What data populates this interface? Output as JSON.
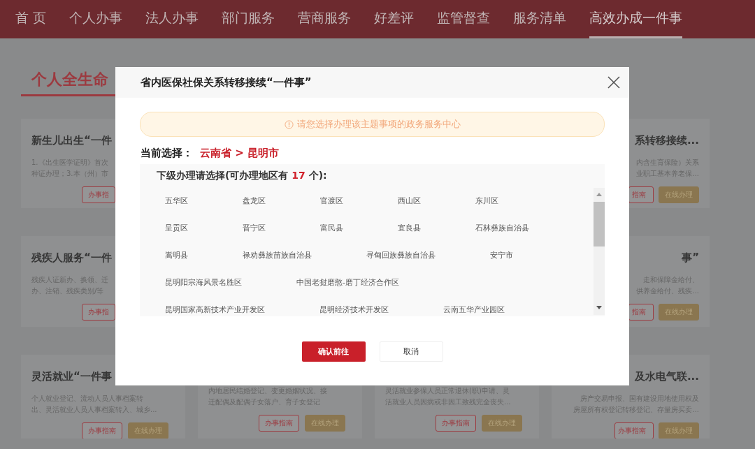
{
  "nav": [
    {
      "label": "首 页",
      "selected": false
    },
    {
      "label": "个人办事",
      "selected": false
    },
    {
      "label": "法人办事",
      "selected": false
    },
    {
      "label": "部门服务",
      "selected": false
    },
    {
      "label": "营商服务",
      "selected": false
    },
    {
      "label": "好差评",
      "selected": false
    },
    {
      "label": "监管督查",
      "selected": false
    },
    {
      "label": "服务清单",
      "selected": false
    },
    {
      "label": "高效办成一件事",
      "selected": true
    }
  ],
  "section_title": "个人全生命",
  "cards_left": [
    {
      "title": "新生儿出生“一件",
      "desc": [
        "1.《出生医学证明》首次",
        "种证办理；3.本（州）市"
      ],
      "buttons": [
        {
          "label": "办事指",
          "kind": "guide"
        }
      ]
    },
    {
      "title": "残疾人服务“一件",
      "desc": [
        "残疾人证新办、换领、迁",
        "办、注销、残疾类别/等"
      ],
      "buttons": [
        {
          "label": "办事指",
          "kind": "guide"
        }
      ]
    },
    {
      "title": "灵活就业“一件事",
      "desc": [
        "个人就业登记、流动人员人事档案转",
        "出、灵活就业人员人事档案转入、城乡..."
      ],
      "buttons": [
        {
          "label": "办事指南",
          "kind": "guide"
        },
        {
          "label": "在线办理",
          "kind": "online"
        }
      ]
    }
  ],
  "cards_bottom_middle": [
    {
      "desc": [
        "内地居民结婚登记、变更婚姻状况、接",
        "迁配偶及配偶子女落户、育子女登记"
      ],
      "buttons": [
        {
          "label": "办事指南",
          "kind": "guide"
        },
        {
          "label": "在线办理",
          "kind": "online"
        }
      ]
    },
    {
      "desc": [
        "灵活就业参保人员正常退休(职)申请、灵",
        "活就业人员因病或非因工致残完全丧失..."
      ],
      "buttons": [
        {
          "label": "办事指南",
          "kind": "guide"
        },
        {
          "label": "在线办理",
          "kind": "online"
        }
      ]
    }
  ],
  "cards_right": [
    {
      "title": "系转移接续...",
      "desc": [
        "内含生育保险）关系",
        "业职工基本养老保..."
      ],
      "buttons": [
        {
          "label": "指南",
          "kind": "guide"
        },
        {
          "label": "在线办理",
          "kind": "online"
        }
      ]
    },
    {
      "title": "事”",
      "desc": [
        "走和保障金给付、",
        "供养金给付、残疾..."
      ],
      "buttons": [
        {
          "label": "指南",
          "kind": "guide"
        },
        {
          "label": "在线办理",
          "kind": "online"
        }
      ]
    },
    {
      "title": "及水电气联...",
      "desc": [
        "房产交易申报、国有建设用地使用权及",
        "房屋所有权登记转移登记、存量房买卖..."
      ],
      "buttons": [
        {
          "label": "办事指南",
          "kind": "guide"
        },
        {
          "label": "在线办理",
          "kind": "online"
        }
      ]
    }
  ],
  "dialog": {
    "title": "省内医保社保关系转移接续“一件事”",
    "alert": "请您选择办理该主题事项的政务服务中心",
    "current_label": "当前选择：",
    "current_value": "云南省 > 昆明市",
    "sub_heading": "下级办理请选择(可办理地区有 **17** 个):",
    "regions": [
      "五华区",
      "盘龙区",
      "官渡区",
      "西山区",
      "东川区",
      "呈贡区",
      "晋宁区",
      "富民县",
      "宜良县",
      "石林彝族自治县",
      "嵩明县",
      "禄劝彝族苗族自治县",
      "寻甸回族彝族自治县",
      "安宁市",
      "昆明阳宗海风景名胜区",
      "中国老挝磨憨-磨丁经济合作区",
      "昆明国家高新技术产业开发区",
      "昆明经济技术开发区",
      "云南五华产业园区"
    ],
    "buttons": [
      {
        "label": "确认前往",
        "kind": "primary"
      },
      {
        "label": "取消",
        "kind": "secondary"
      }
    ]
  }
}
